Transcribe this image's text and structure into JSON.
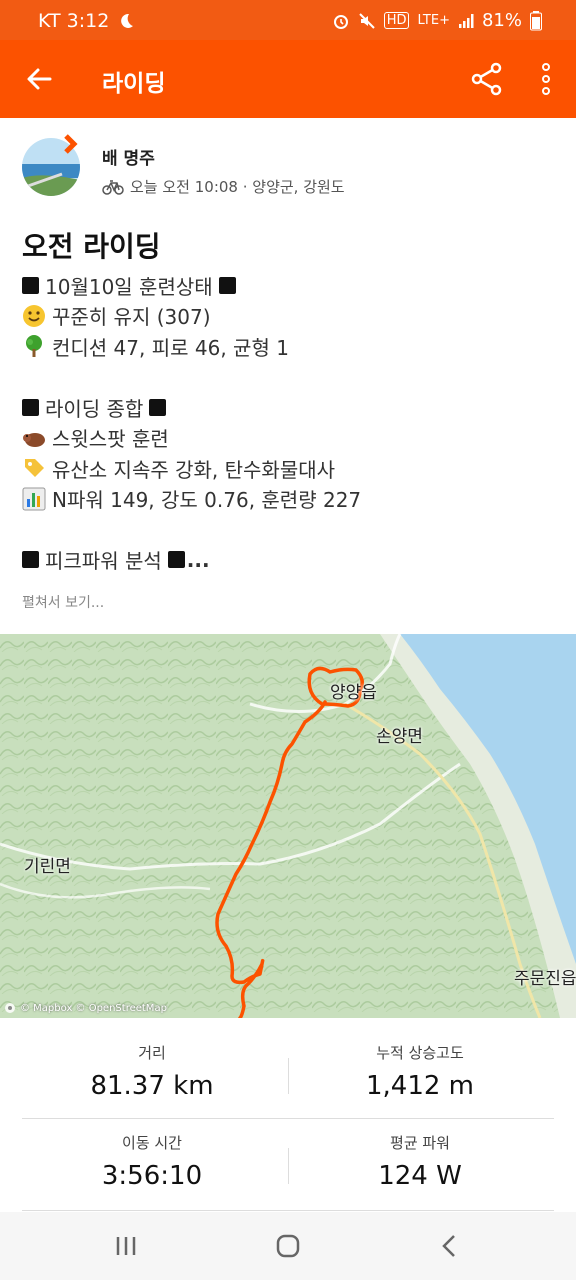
{
  "status_bar": {
    "carrier_time": "KT 3:12",
    "network": "LTE+",
    "battery": "81%",
    "icons": [
      "moon-icon",
      "alarm-icon",
      "mute-icon",
      "hd-icon",
      "signal-icon",
      "battery-icon"
    ]
  },
  "app_bar": {
    "title": "라이딩",
    "icons": [
      "back-arrow-icon",
      "share-icon",
      "more-vertical-icon"
    ]
  },
  "athlete": {
    "name": "배 명주",
    "meta": "오늘 오전 10:08 · 양양군, 강원도",
    "meta_icon": "bicycle-icon"
  },
  "activity": {
    "title": "오전 라이딩",
    "description": [
      {
        "icon": "black-square",
        "text": "10월10일 훈련상태",
        "trail": "black-square"
      },
      {
        "icon": "smile-emoji",
        "text": "꾸준히 유지 (307)"
      },
      {
        "icon": "tree-emoji",
        "text": "컨디션 47, 피로 46, 균형 1"
      },
      {
        "icon": "",
        "text": ""
      },
      {
        "icon": "black-square",
        "text": "라이딩 종합",
        "trail": "black-square"
      },
      {
        "icon": "boar-emoji",
        "text": "스윗스팟 훈련"
      },
      {
        "icon": "tag-emoji",
        "text": "유산소 지속주 강화, 탄수화물대사"
      },
      {
        "icon": "chart-emoji",
        "text": "N파워 149, 강도 0.76, 훈련량 227"
      },
      {
        "icon": "",
        "text": ""
      },
      {
        "icon": "black-square",
        "text": "피크파워 분석",
        "trail": "black-square",
        "suffix": "..."
      }
    ],
    "see_more": "펼쳐서 보기..."
  },
  "map": {
    "labels": {
      "yangyang": "양양읍",
      "sonyang": "손양면",
      "girin": "기린면",
      "jumunjin": "주문진읍"
    },
    "attribution": "© Mapbox © OpenStreetMap",
    "route_color": "#fc5200",
    "sea_color": "#a9d4ef"
  },
  "stats": [
    {
      "label": "거리",
      "value": "81.37 km"
    },
    {
      "label": "누적 상승고도",
      "value": "1,412 m"
    },
    {
      "label": "이동 시간",
      "value": "3:56:10"
    },
    {
      "label": "평균 파워",
      "value": "124 W"
    }
  ],
  "nav_bar": {
    "icons": [
      "recent-apps-icon",
      "home-icon",
      "back-icon"
    ]
  },
  "colors": {
    "brand": "#fc5200",
    "status_bar": "#f25b13"
  }
}
